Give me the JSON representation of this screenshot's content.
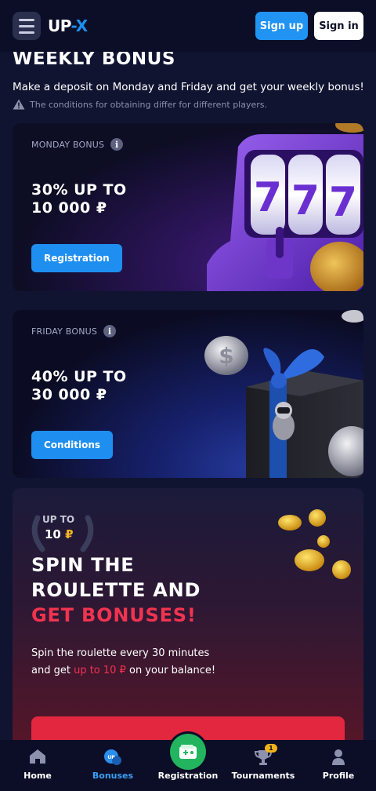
{
  "header": {
    "logo_text_up": "UP",
    "logo_text_dash": "-",
    "logo_text_x": "X",
    "signup_label": "Sign up",
    "signin_label": "Sign in"
  },
  "page": {
    "title": "WEEKLY BONUS",
    "subtitle": "Make a deposit on Monday and Friday and get your weekly bonus!",
    "note": "The conditions for obtaining differ for different players."
  },
  "monday_card": {
    "label": "MONDAY BONUS",
    "amount_line1": "30% UP TO",
    "amount_line2": "10 000 ₽",
    "button": "Registration",
    "reel_digit": "7"
  },
  "friday_card": {
    "label": "FRIDAY BONUS",
    "amount_line1": "40% UP TO",
    "amount_line2": "30 000 ₽",
    "button": "Conditions",
    "coin_symbol": "$"
  },
  "roulette": {
    "upto_label": "UP TO",
    "upto_value": "10",
    "upto_currency": "₽",
    "title_line1": "SPIN THE",
    "title_line2": "ROULETTE AND",
    "title_line3": "GET BONUSES!",
    "desc_part1": "Spin the roulette every 30 minutes",
    "desc_part2": "and get",
    "desc_highlight": "up to 10 ₽",
    "desc_part3": "on your balance!"
  },
  "bottom_nav": {
    "items": [
      {
        "label": "Home",
        "icon": "home-icon"
      },
      {
        "label": "Bonuses",
        "icon": "bonuses-icon",
        "active": true
      },
      {
        "label": "Registration",
        "icon": "wallet-plus-icon"
      },
      {
        "label": "Tournaments",
        "icon": "trophy-icon",
        "badge": "1"
      },
      {
        "label": "Profile",
        "icon": "user-icon"
      }
    ]
  },
  "colors": {
    "accent_blue": "#1f8ef1",
    "accent_red": "#f2334f",
    "accent_green": "#22b45f",
    "background": "#101431"
  }
}
